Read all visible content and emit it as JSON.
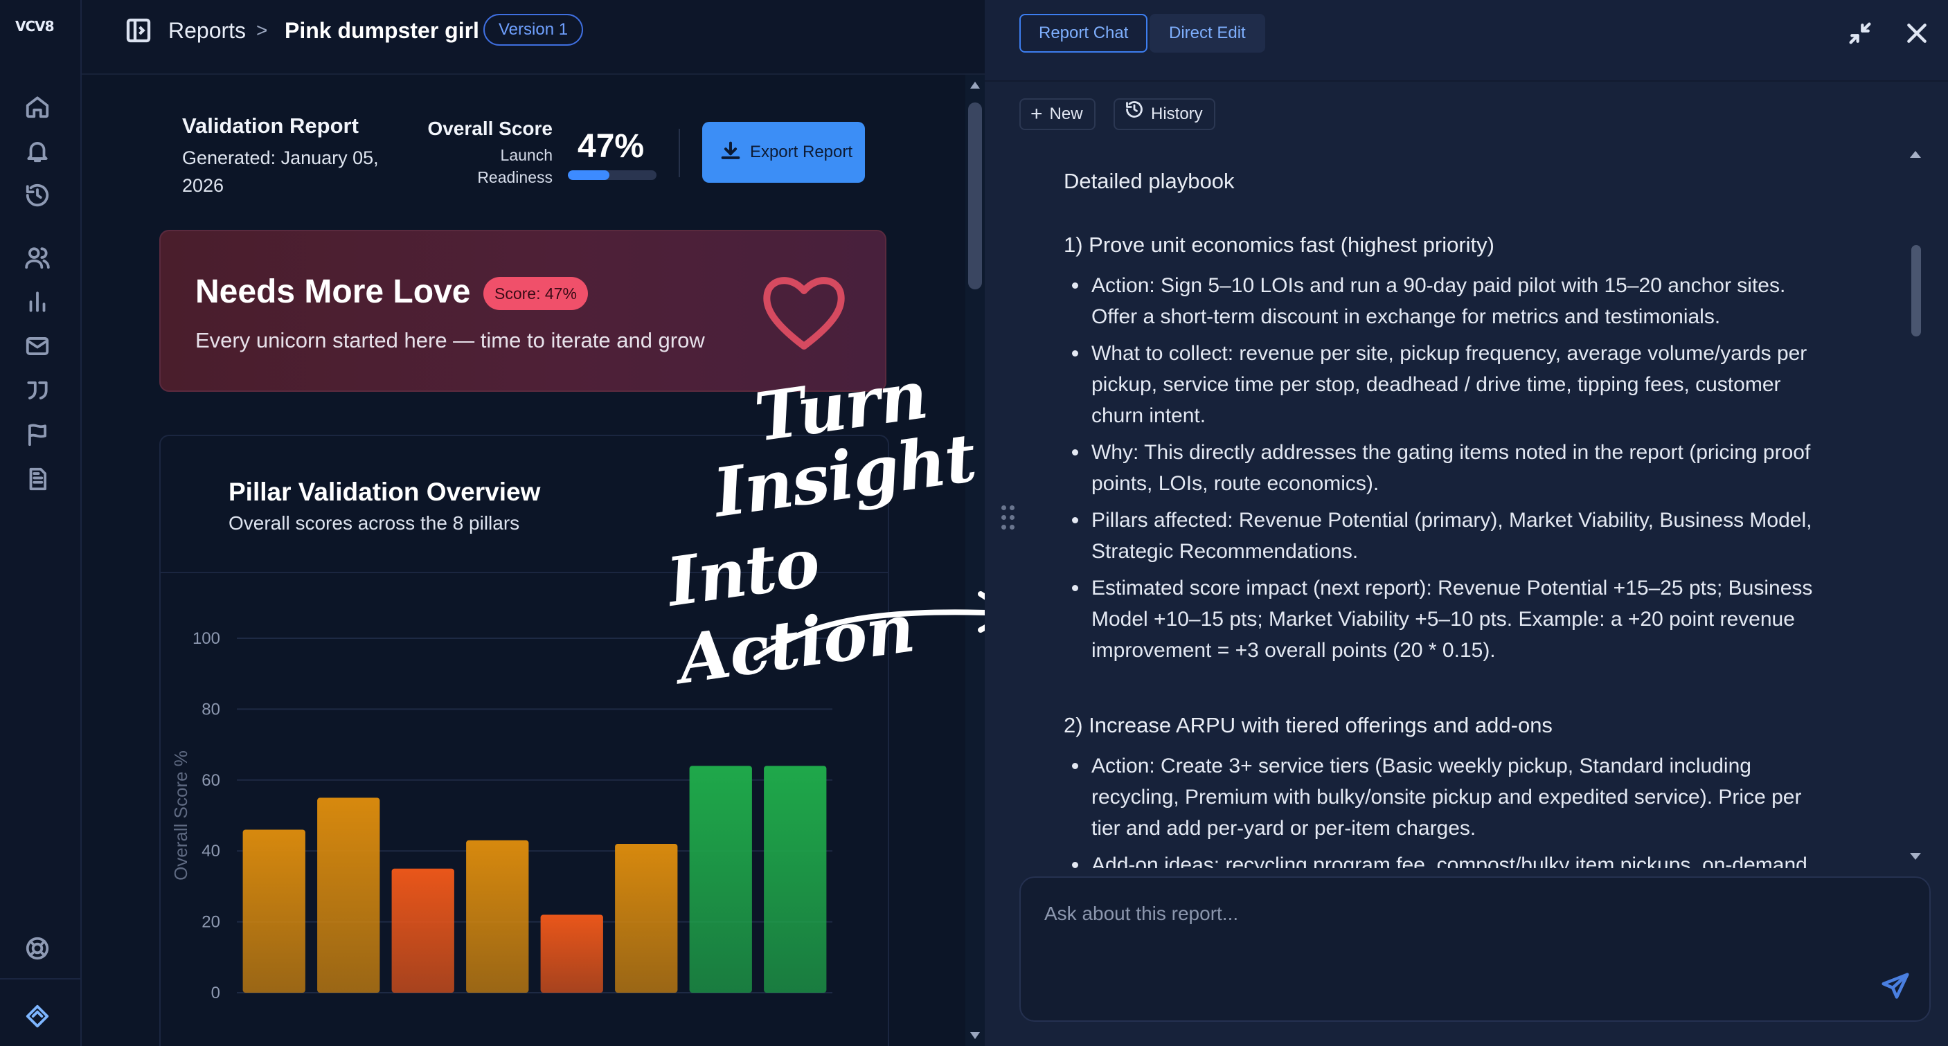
{
  "app": {
    "logo_text": "VCV8"
  },
  "sidebar": {
    "icons": [
      "home-icon",
      "bell-icon",
      "history-icon",
      "users-icon",
      "bar-chart-icon",
      "mail-icon",
      "quote-icon",
      "flag-icon",
      "document-icon",
      "lifebuoy-icon",
      "brand-diamond-icon"
    ]
  },
  "breadcrumb": {
    "root": "Reports",
    "separator": ">",
    "current": "Pink dumpster girl",
    "version": "Version 1"
  },
  "report": {
    "title": "Validation Report",
    "generated": "Generated: January 05, 2026",
    "overall_score_label": "Overall Score",
    "overall_score_sub": "Launch Readiness",
    "overall_score_value": "47%",
    "overall_score_fraction": 0.47,
    "export_label": "Export Report"
  },
  "status_card": {
    "title": "Needs More Love",
    "score_badge": "Score: 47%",
    "subtitle": "Every unicorn started here — time to iterate and grow"
  },
  "chart_card": {
    "title": "Pillar Validation Overview",
    "subtitle": "Overall scores across the 8 pillars"
  },
  "chart_data": {
    "type": "bar",
    "categories": [
      "",
      "",
      "",
      "",
      "",
      "",
      "",
      ""
    ],
    "values": [
      46,
      55,
      35,
      43,
      22,
      42,
      64,
      64
    ],
    "bar_colors": [
      "#d7890e",
      "#d7890e",
      "#e9561a",
      "#d7890e",
      "#e9561a",
      "#d7890e",
      "#1fa84a",
      "#1fa84a"
    ],
    "ylabel": "Overall Score %",
    "ylim": [
      0,
      100
    ],
    "yticks": [
      "0",
      "20",
      "40",
      "60",
      "80",
      "100"
    ],
    "grid": true
  },
  "overlay": {
    "line1": "Turn",
    "line2": "Insight",
    "line3": "Into Action"
  },
  "right_panel": {
    "tab_chat": "Report Chat",
    "tab_edit": "Direct Edit",
    "new_label": "New",
    "history_label": "History",
    "heading": "Detailed playbook",
    "section1_title": "1) Prove unit economics fast (highest priority)",
    "section1_bullets": [
      "Action: Sign 5–10 LOIs and run a 90-day paid pilot with 15–20 anchor sites. Offer a short-term discount in exchange for metrics and testimonials.",
      "What to collect: revenue per site, pickup frequency, average volume/yards per pickup, service time per stop, deadhead / drive time, tipping fees, customer churn intent.",
      "Why: This directly addresses the gating items noted in the report (pricing proof points, LOIs, route economics).",
      "Pillars affected: Revenue Potential (primary), Market Viability, Business Model, Strategic Recommendations.",
      "Estimated score impact (next report): Revenue Potential +15–25 pts; Business Model +10–15 pts; Market Viability +5–10 pts. Example: a +20 point revenue improvement = +3 overall points (20 * 0.15)."
    ],
    "section2_title": "2) Increase ARPU with tiered offerings and add-ons",
    "section2_bullets": [
      "Action: Create 3+ service tiers (Basic weekly pickup, Standard including recycling, Premium with bulky/onsite pickup and expedited service). Price per tier and add per-yard or per-item charges.",
      "Add-on ideas: recycling program fee, compost/bulky item pickups, on-demand"
    ],
    "input_placeholder": "Ask about this report..."
  }
}
